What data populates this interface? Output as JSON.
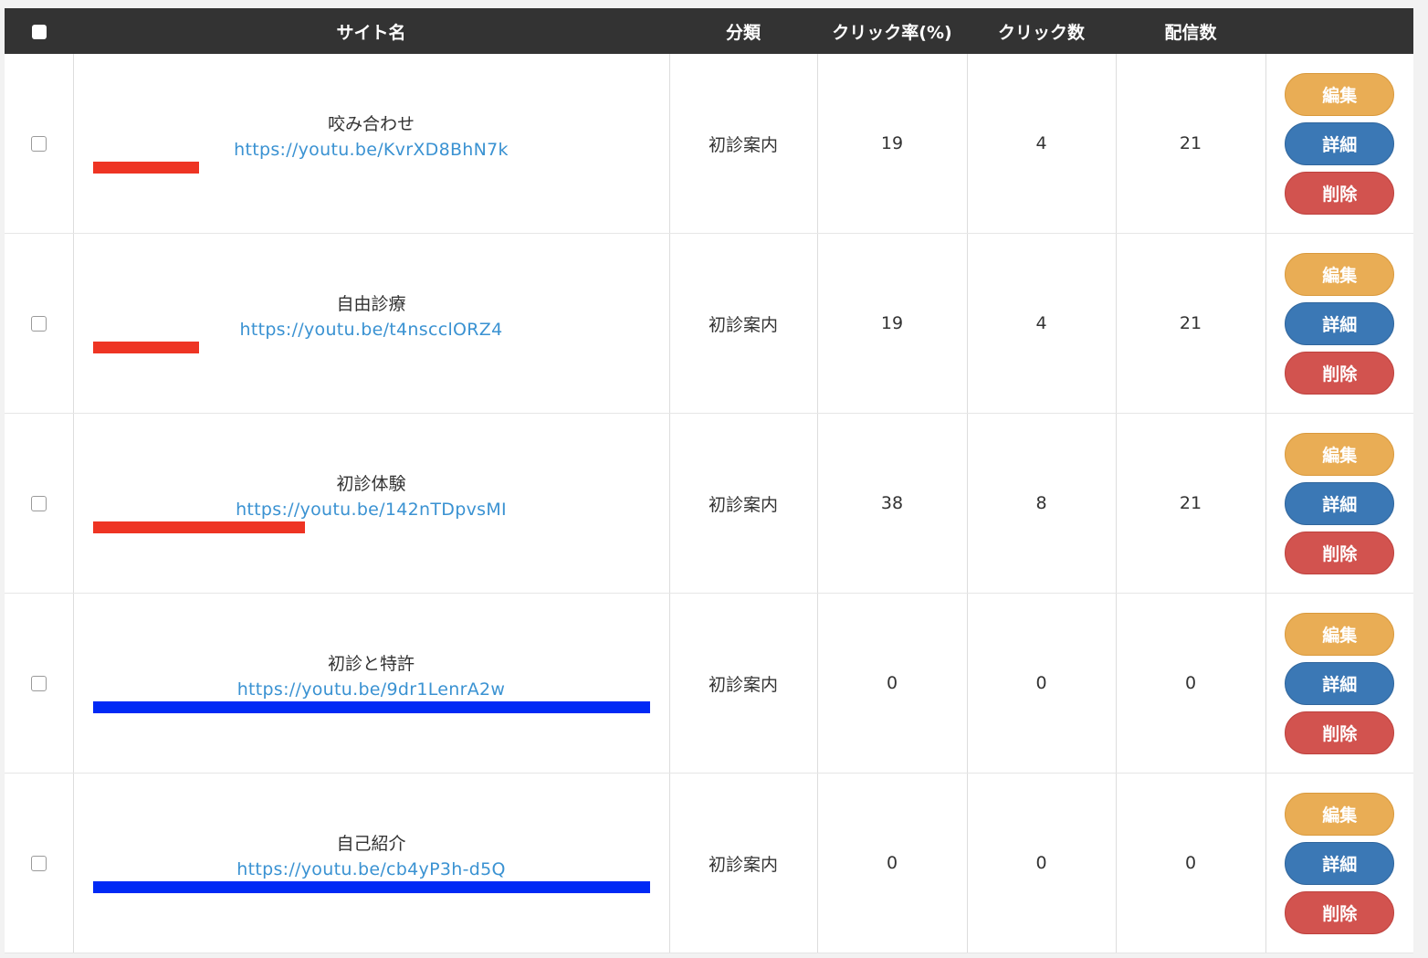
{
  "header": {
    "site_name": "サイト名",
    "category": "分類",
    "click_rate": "クリック率(%)",
    "clicks": "クリック数",
    "deliveries": "配信数"
  },
  "buttons": {
    "edit": "編集",
    "detail": "詳細",
    "delete": "削除"
  },
  "colors": {
    "bar_low": "#ee3423",
    "bar_zero": "#0029f5"
  },
  "rows": [
    {
      "name": "咬み合わせ",
      "url": "https://youtu.be/KvrXD8BhN7k",
      "category": "初診案内",
      "click_rate": "19",
      "clicks": "4",
      "deliveries": "21",
      "bar_fraction": 0.19,
      "bar_color": "#ee3423"
    },
    {
      "name": "自由診療",
      "url": "https://youtu.be/t4nscclORZ4",
      "category": "初診案内",
      "click_rate": "19",
      "clicks": "4",
      "deliveries": "21",
      "bar_fraction": 0.19,
      "bar_color": "#ee3423"
    },
    {
      "name": "初診体験",
      "url": "https://youtu.be/142nTDpvsMI",
      "category": "初診案内",
      "click_rate": "38",
      "clicks": "8",
      "deliveries": "21",
      "bar_fraction": 0.38,
      "bar_color": "#ee3423"
    },
    {
      "name": "初診と特許",
      "url": "https://youtu.be/9dr1LenrA2w",
      "category": "初診案内",
      "click_rate": "0",
      "clicks": "0",
      "deliveries": "0",
      "bar_fraction": 1.0,
      "bar_color": "#0029f5"
    },
    {
      "name": "自己紹介",
      "url": "https://youtu.be/cb4yP3h-d5Q",
      "category": "初診案内",
      "click_rate": "0",
      "clicks": "0",
      "deliveries": "0",
      "bar_fraction": 1.0,
      "bar_color": "#0029f5"
    }
  ]
}
